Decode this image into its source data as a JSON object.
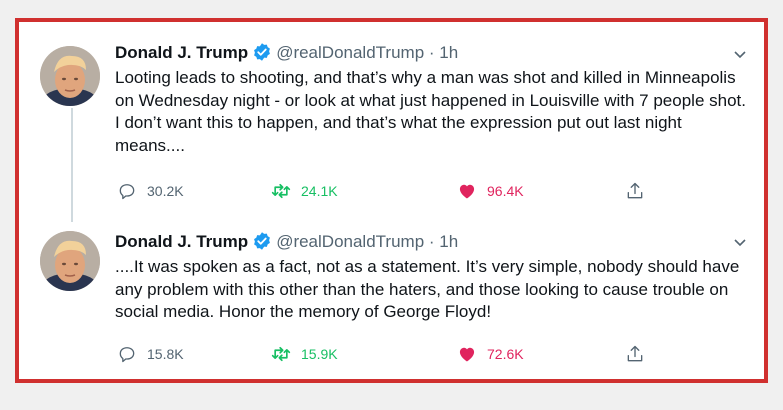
{
  "colors": {
    "frame_border": "#d0302f",
    "verified": "#1d9bf0",
    "retweet": "#17bf63",
    "like": "#e0245e",
    "muted": "#536471"
  },
  "tweets": [
    {
      "author_name": "Donald J. Trump",
      "handle_time": "@realDonaldTrump · 1h",
      "text": "Looting leads to shooting, and that’s why a man was shot and killed in Minneapolis on Wednesday night - or look at what just happened in Louisville with 7 people shot. I don’t want this to happen, and that’s what the expression put out last night means....",
      "replies": "30.2K",
      "retweets": "24.1K",
      "likes": "96.4K"
    },
    {
      "author_name": "Donald J. Trump",
      "handle_time": "@realDonaldTrump · 1h",
      "text": "....It was spoken as a fact, not as a statement. It’s very simple, nobody should have any problem with this other than the haters, and those looking to cause trouble on social media. Honor the memory of George Floyd!",
      "replies": "15.8K",
      "retweets": "15.9K",
      "likes": "72.6K"
    }
  ],
  "icons": {
    "reply": "reply-icon",
    "retweet": "retweet-icon",
    "like": "heart-icon",
    "share": "share-icon",
    "verified": "verified-badge-icon",
    "more": "chevron-down-icon"
  }
}
